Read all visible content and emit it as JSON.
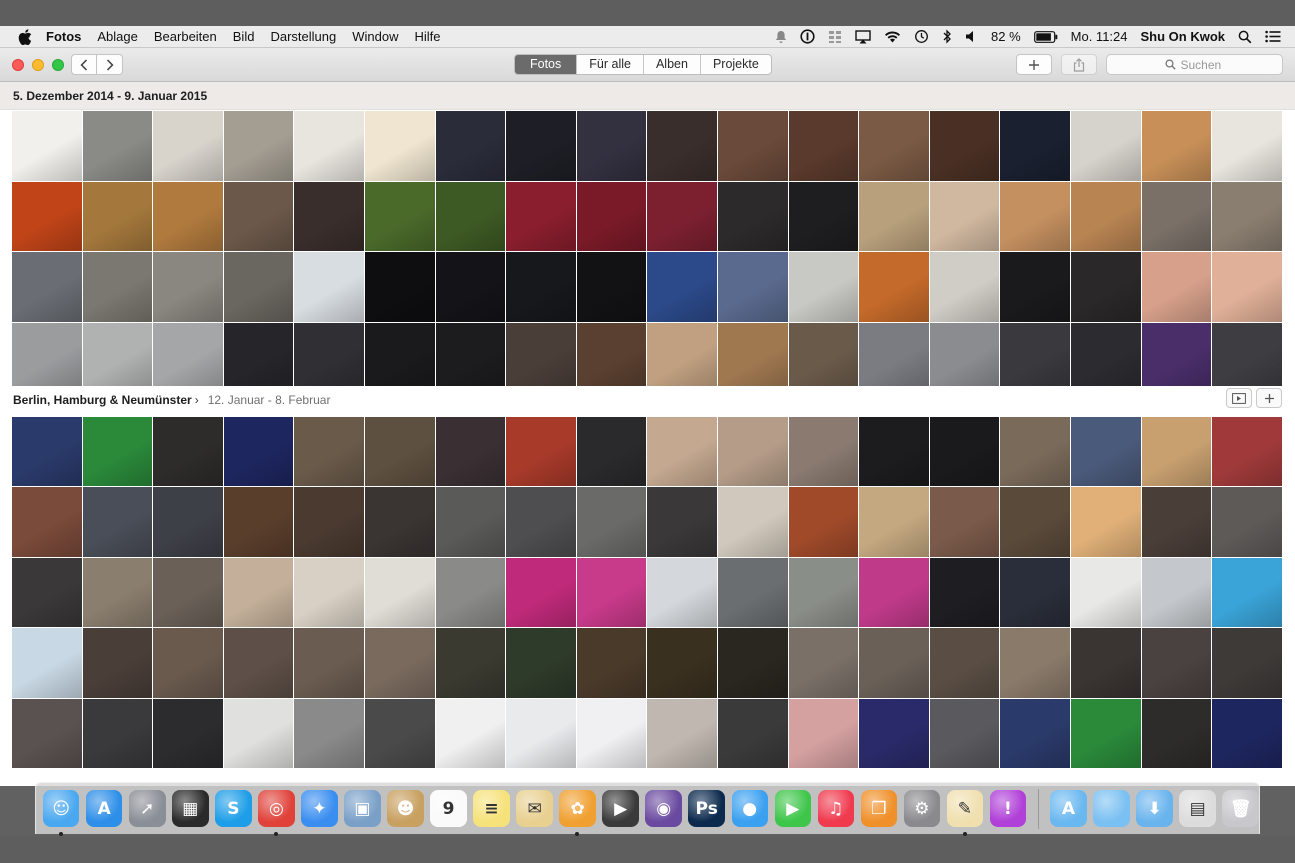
{
  "menubar": {
    "app_name": "Fotos",
    "menus": [
      "Ablage",
      "Bearbeiten",
      "Bild",
      "Darstellung",
      "Window",
      "Hilfe"
    ],
    "battery": "82 %",
    "clock": "Mo. 11:24",
    "user": "Shu On Kwok"
  },
  "toolbar": {
    "tabs": [
      {
        "label": "Fotos",
        "active": true
      },
      {
        "label": "Für alle",
        "active": false
      },
      {
        "label": "Alben",
        "active": false
      },
      {
        "label": "Projekte",
        "active": false
      }
    ],
    "search_placeholder": "Suchen",
    "add_label": "+"
  },
  "sections": [
    {
      "title": "5. Dezember 2014 - 9. Januar 2015",
      "subtitle": "",
      "palette": [
        "#f2f0ec",
        "#8a8a86",
        "#d8d4cc",
        "#a39d92",
        "#e8e5df",
        "#efe5d0",
        "#2a2c3a",
        "#1e1e26",
        "#333040",
        "#3a2e2c",
        "#6a4a3a",
        "#5a3a2c",
        "#7a5a44",
        "#4a3024",
        "#1a2030",
        "#d6d2cc",
        "#c89058",
        "#e8e4de",
        "#c04418",
        "#a4783c",
        "#b07a3e",
        "#6b584a",
        "#3a2e2c",
        "#4a6a2a",
        "#3e5a24",
        "#8a1e2e",
        "#7a1a28",
        "#7c2030",
        "#2c2a2a",
        "#1e1e20",
        "#b8a07c",
        "#d0b8a0",
        "#c49060",
        "#b88452",
        "#7a7068",
        "#8a7e70",
        "#6a6e74",
        "#7a7870",
        "#8a8680",
        "#6a6660",
        "#d8dde2",
        "#0e0e10",
        "#141418",
        "#16181c",
        "#121214",
        "#2c4a8a",
        "#5a6a8e",
        "#c8c8c4",
        "#c46a2a",
        "#d0ccc6",
        "#1a1a1c",
        "#2a2828",
        "#d6a08a",
        "#e0b098",
        "#9a9c9e",
        "#b0b2b2",
        "#a4a6a8",
        "#26262a",
        "#303034",
        "#1a1a1c",
        "#1c1c1e",
        "#4a3e38",
        "#5a4030",
        "#c0a080",
        "#a07850",
        "#6a5a4a",
        "#7a7c82",
        "#8a8c90",
        "#3a3a3e",
        "#2c2c30",
        "#4a2e6a",
        "#3e3e42",
        "#d06a4a"
      ]
    },
    {
      "title": "Berlin, Hamburg & Neumünster",
      "subtitle": "12. Januar - 8. Februar",
      "palette": [
        "#2a3a6a",
        "#2a8a3a",
        "#2e2c2a",
        "#1e2660",
        "#6a5a4a",
        "#5e5040",
        "#3a3034",
        "#a83a2a",
        "#2a2a2c",
        "#c4a890",
        "#b49c88",
        "#8a7a70",
        "#1c1c1e",
        "#1a1a1c",
        "#7a6a5a",
        "#4a5a7a",
        "#c8a070",
        "#a03a3a",
        "#7a4a3a",
        "#4a4e58",
        "#3e4048",
        "#5a3e2c",
        "#4a3a30",
        "#3a3432",
        "#5a5a58",
        "#4e4e50",
        "#6a6a68",
        "#3a3838",
        "#d0c8bc",
        "#a04a2a",
        "#c4a880",
        "#7a5a4a",
        "#5a4a3a",
        "#e0b078",
        "#4a3e38",
        "#5e5a58",
        "#3a3838",
        "#8a7e6e",
        "#6a6058",
        "#c4b09a",
        "#d8d0c4",
        "#e0dcd6",
        "#8a8a88",
        "#c02a7a",
        "#c83a8a",
        "#d4d8dc",
        "#6a6e70",
        "#8a8e88",
        "#c03a8a",
        "#1e1e22",
        "#2a2e3a",
        "#e8e8e6",
        "#c4c8cc",
        "#3aa4d8",
        "#c8d8e4",
        "#4a3e38",
        "#6a5a4e",
        "#5e5048",
        "#6a5c50",
        "#7a6a5e",
        "#3a3a30",
        "#2e3a2a",
        "#4a3a2a",
        "#3a3020",
        "#2a2620",
        "#7a7068",
        "#6a6058",
        "#5a4e44",
        "#8a7a6a",
        "#3a3432",
        "#4a4240",
        "#3e3a38",
        "#5a5250",
        "#3a3a3c",
        "#2c2c2e",
        "#e0e0de",
        "#8a8a8a",
        "#4a4a4a",
        "#f0f0f0",
        "#e8eaec",
        "#f0f0f2",
        "#c0b8b0",
        "#3a3a3a",
        "#d4a0a0",
        "#2a2a6a",
        "#5a5a5e"
      ]
    }
  ],
  "dock": {
    "apps": [
      {
        "name": "finder",
        "color": "#4aa8f0",
        "glyph": "☺"
      },
      {
        "name": "app-store",
        "color": "#2e8fe8",
        "glyph": "A"
      },
      {
        "name": "launchpad",
        "color": "#8a8e96",
        "glyph": "➚"
      },
      {
        "name": "dashboard",
        "color": "#2a2a2a",
        "glyph": "▦"
      },
      {
        "name": "skype",
        "color": "#1e9ee8",
        "glyph": "S"
      },
      {
        "name": "chrome",
        "color": "#e0423a",
        "glyph": "◎"
      },
      {
        "name": "safari",
        "color": "#3a8ef0",
        "glyph": "✦"
      },
      {
        "name": "preview",
        "color": "#7aa0c8",
        "glyph": "▣"
      },
      {
        "name": "contacts",
        "color": "#c8a060",
        "glyph": "☻"
      },
      {
        "name": "calendar",
        "color": "#fafafa",
        "glyph": "9"
      },
      {
        "name": "notes",
        "color": "#f6e27a",
        "glyph": "≡"
      },
      {
        "name": "preview-2",
        "color": "#e8d090",
        "glyph": "✉"
      },
      {
        "name": "photos",
        "color": "#f0a030",
        "glyph": "✿"
      },
      {
        "name": "final-cut",
        "color": "#3a3a3a",
        "glyph": "▶"
      },
      {
        "name": "motion",
        "color": "#6a4aa0",
        "glyph": "◉"
      },
      {
        "name": "photoshop",
        "color": "#0c2a4e",
        "glyph": "Ps"
      },
      {
        "name": "messages",
        "color": "#3aa0f0",
        "glyph": "●"
      },
      {
        "name": "facetime",
        "color": "#3ec64a",
        "glyph": "▶"
      },
      {
        "name": "itunes",
        "color": "#f03a4e",
        "glyph": "♫"
      },
      {
        "name": "ibooks",
        "color": "#f0902a",
        "glyph": "❐"
      },
      {
        "name": "system-preferences",
        "color": "#8a8a8e",
        "glyph": "⚙"
      },
      {
        "name": "textedit",
        "color": "#f0e0b0",
        "glyph": "✎"
      },
      {
        "name": "feedback",
        "color": "#b040d8",
        "glyph": "!"
      }
    ],
    "folders": [
      {
        "name": "applications-folder",
        "color": "#6ab8f0",
        "glyph": "A"
      },
      {
        "name": "documents-folder",
        "color": "#7ac0f2",
        "glyph": ""
      },
      {
        "name": "downloads-folder",
        "color": "#6ab4ee",
        "glyph": "⬇"
      },
      {
        "name": "recent-window",
        "color": "#dcdcdc",
        "glyph": "▤"
      },
      {
        "name": "trash",
        "color": "#c8c8cc",
        "glyph": "🗑"
      }
    ],
    "running": [
      "finder",
      "chrome",
      "photos",
      "textedit"
    ]
  }
}
